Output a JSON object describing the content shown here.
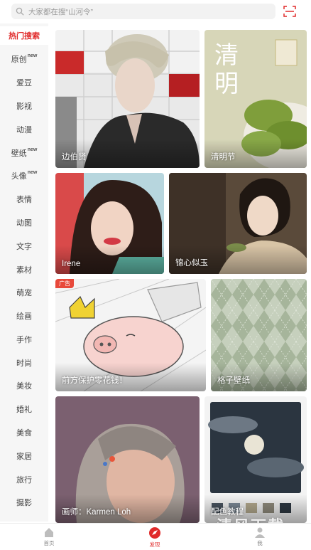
{
  "search": {
    "placeholder": "大家都在搜“山河令”"
  },
  "sidebar": {
    "items": [
      {
        "label": "热门搜索",
        "badge": "",
        "active": true
      },
      {
        "label": "原创",
        "badge": "new"
      },
      {
        "label": "爱豆",
        "badge": ""
      },
      {
        "label": "影视",
        "badge": ""
      },
      {
        "label": "动漫",
        "badge": ""
      },
      {
        "label": "壁纸",
        "badge": "new"
      },
      {
        "label": "头像",
        "badge": "new"
      },
      {
        "label": "表情",
        "badge": ""
      },
      {
        "label": "动图",
        "badge": ""
      },
      {
        "label": "文字",
        "badge": ""
      },
      {
        "label": "素材",
        "badge": ""
      },
      {
        "label": "萌宠",
        "badge": ""
      },
      {
        "label": "绘画",
        "badge": ""
      },
      {
        "label": "手作",
        "badge": ""
      },
      {
        "label": "时尚",
        "badge": ""
      },
      {
        "label": "美妆",
        "badge": ""
      },
      {
        "label": "婚礼",
        "badge": ""
      },
      {
        "label": "美食",
        "badge": ""
      },
      {
        "label": "家居",
        "badge": ""
      },
      {
        "label": "旅行",
        "badge": ""
      },
      {
        "label": "摄影",
        "badge": ""
      }
    ]
  },
  "cards": [
    {
      "caption": "边伯贤"
    },
    {
      "caption": "清明节",
      "art_text": "清明"
    },
    {
      "caption": "Irene"
    },
    {
      "caption": "锦心似玉"
    },
    {
      "caption": "前方保护零花钱！",
      "ad": "广告"
    },
    {
      "caption": "格子壁纸"
    },
    {
      "caption": "画师：Karmen Loh"
    },
    {
      "caption": "配色教程"
    }
  ],
  "tabbar": {
    "tabs": [
      {
        "label": "首页",
        "icon": "home-icon"
      },
      {
        "label": "发现",
        "icon": "discover-icon",
        "active": true
      },
      {
        "label": "我",
        "icon": "profile-icon"
      }
    ]
  },
  "watermark": "清风下载",
  "colors": {
    "accent": "#e02a2a",
    "sidebar_bg": "#f6f6f6",
    "search_bg": "#f2f2f2"
  }
}
